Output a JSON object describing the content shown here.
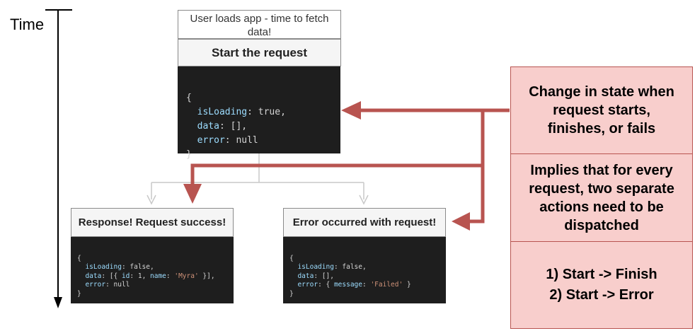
{
  "time_axis": {
    "label": "Time"
  },
  "start_block": {
    "note": "User loads app - time to fetch data!",
    "header": "Start the request",
    "code": {
      "open": "{",
      "k1": "isLoading",
      "v1": ": true,",
      "k2": "data",
      "v2": ": [],",
      "k3": "error",
      "v3": ": null",
      "close": "}"
    }
  },
  "success_block": {
    "header": "Response! Request success!",
    "code": {
      "open": "{",
      "k1": "isLoading",
      "v1": ": false,",
      "k2": "data",
      "v2a": ": [{ ",
      "k2b": "id",
      "v2b": ": 1, ",
      "k2c": "name",
      "v2c": ": ",
      "s2": "'Myra'",
      "v2d": " }],",
      "k3": "error",
      "v3": ": null",
      "close": "}"
    }
  },
  "error_block": {
    "header": "Error occurred with request!",
    "code": {
      "open": "{",
      "k1": "isLoading",
      "v1": ": false,",
      "k2": "data",
      "v2": ": [],",
      "k3": "error",
      "v3a": ": { ",
      "k3b": "message",
      "v3b": ": ",
      "s3": "'Failed'",
      "v3c": " }",
      "close": "}"
    }
  },
  "explanation": {
    "state_change_lines": [
      "Change in state when",
      "request starts,",
      "finishes, or fails"
    ],
    "implies_lines": [
      "Implies that for every",
      "request, two separate",
      "actions need to be",
      "dispatched"
    ],
    "flows": [
      "1) Start -> Finish",
      "2) Start -> Error"
    ]
  },
  "colors": {
    "accent_red": "#b85450",
    "red_fill": "#f8cecc",
    "code_bg": "#1e1e1e",
    "grey_connector": "#c8c8c8"
  }
}
